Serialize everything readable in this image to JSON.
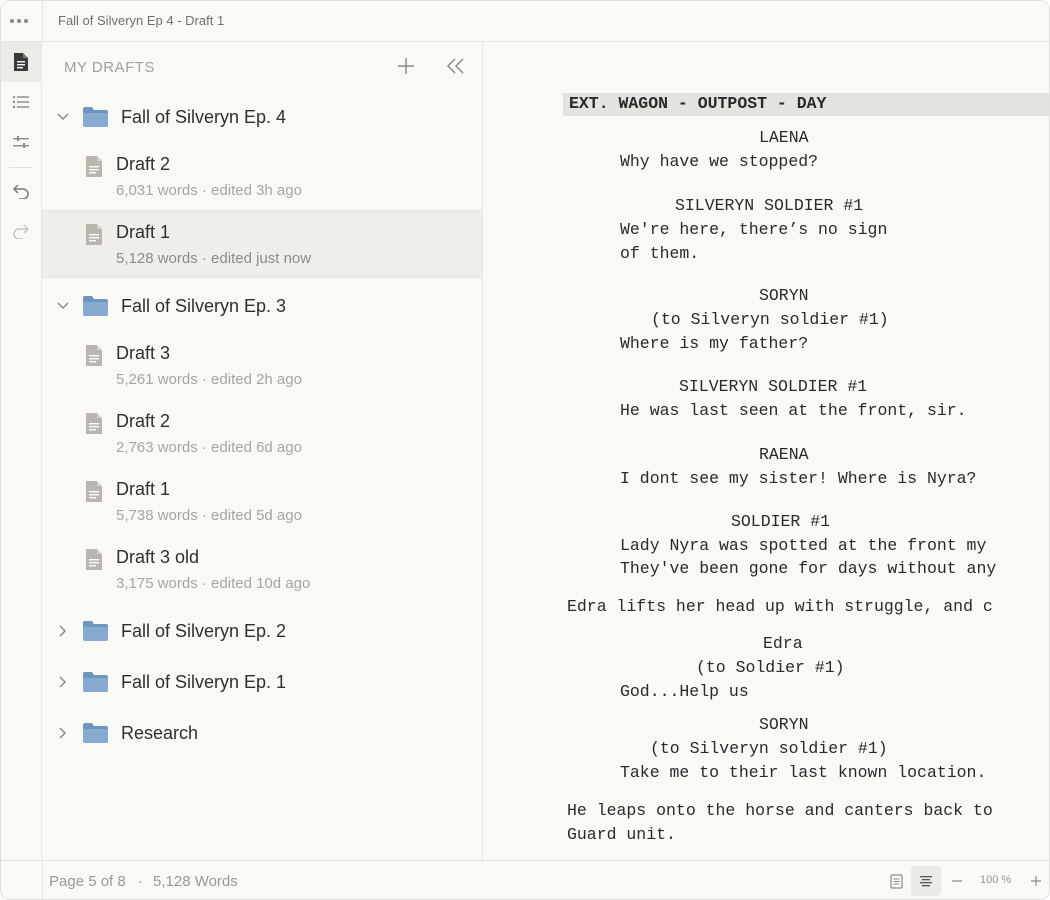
{
  "window": {
    "title": "Fall of Silveryn Ep 4 - Draft 1"
  },
  "sidebar": {
    "header": "MY DRAFTS",
    "folders": [
      {
        "name": "Fall of Silveryn Ep. 4",
        "expanded": true
      },
      {
        "name": "Fall of Silveryn Ep. 3",
        "expanded": true
      },
      {
        "name": "Fall of Silveryn Ep. 2",
        "expanded": false
      },
      {
        "name": "Fall of Silveryn Ep. 1",
        "expanded": false
      },
      {
        "name": "Research",
        "expanded": false
      }
    ],
    "docs": [
      {
        "name": "Draft 2",
        "meta": "6,031 words · edited 3h ago"
      },
      {
        "name": "Draft 1",
        "meta": "5,128  words · edited just now",
        "selected": true
      },
      {
        "name": "Draft 3",
        "meta": "5,261 words · edited 2h ago"
      },
      {
        "name": "Draft 2",
        "meta": "2,763 words · edited 6d ago"
      },
      {
        "name": "Draft 1",
        "meta": "5,738 words · edited 5d ago"
      },
      {
        "name": "Draft 3 old",
        "meta": "3,175 words · edited 10d ago"
      }
    ]
  },
  "script": {
    "scene_heading": "EXT. WAGON - OUTPOST - DAY",
    "lines": [
      "LAENA",
      "Why have we stopped?",
      "SILVERYN SOLDIER #1",
      "We're here, there’s no sign",
      "of them.",
      "SORYN",
      "(to Silveryn soldier #1)",
      "Where is my father?",
      "SILVERYN SOLDIER #1",
      "He was last seen at the front, sir.",
      "RAENA",
      "I dont see my sister! Where is Nyra?",
      "SOLDIER #1",
      "Lady Nyra was spotted at the front my",
      "They've been gone for days without any",
      "Edra lifts her head up with struggle, and c",
      "Edra",
      "(to Soldier #1)",
      "God...Help us",
      "SORYN",
      "(to Silveryn soldier #1)",
      "Take me to their last known location.",
      "He leaps onto the horse and canters back to",
      "Guard unit."
    ]
  },
  "status": {
    "page": "Page 5 of 8",
    "separator": "·",
    "words": "5,128 Words",
    "zoom": "100 %"
  },
  "icons": {
    "more": "more-dots-icon",
    "documents": "document-icon",
    "outline": "list-icon",
    "settings": "sliders-icon",
    "undo": "undo-icon",
    "redo": "redo-icon",
    "folder": "folder-icon",
    "file": "file-icon"
  },
  "colors": {
    "folder": "#7ea3c8",
    "file": "#b9b6ae",
    "background": "#faf9f6",
    "selected": "#efeeea",
    "scene_bg": "#e4e3df"
  }
}
